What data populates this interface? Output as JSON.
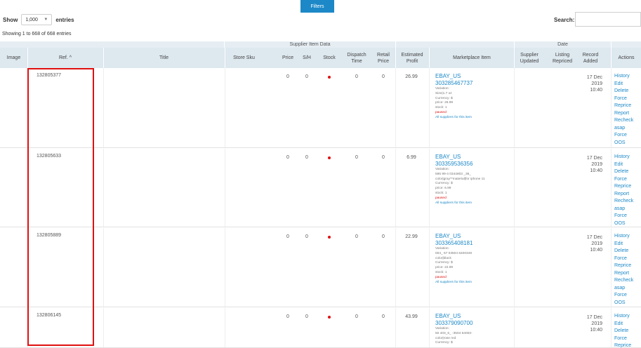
{
  "toolbar": {
    "filters_label": "Filters"
  },
  "length": {
    "show_label": "Show",
    "value": "1,000",
    "entries_label": "entries"
  },
  "search": {
    "label": "Search:",
    "value": ""
  },
  "info": "Showing 1 to 668 of 668 entries",
  "groups": {
    "supplier": "Supplier Item Data",
    "date": "Date"
  },
  "headers": {
    "image": "Image",
    "ref": "Ref. ^",
    "title": "Title",
    "store_sku": "Store Sku",
    "price": "Price",
    "sh": "S/H",
    "stock": "Stock",
    "dispatch": "Dispatch Time",
    "retail": "Retail Price",
    "profit": "Estimated Profit",
    "market": "Marketplace Item",
    "supplier_updated": "Supplier Updated",
    "listing_repriced": "Listing Repriced",
    "record_added": "Record Added",
    "actions": "Actions"
  },
  "colors": {
    "accent": "#1c88c7",
    "stock_dot": "#e01010",
    "highlight": "#e01010"
  },
  "rows": [
    {
      "ref": "132805377",
      "price": "0",
      "sh": "0",
      "dispatch": "0",
      "retail": "0",
      "profit": "26.99",
      "market": "EBAY_US",
      "item_id": "303285467737",
      "details": [
        "Variation:",
        "Size|1.7 oz",
        "Currency: $",
        "price: 26.99",
        "stock: 1"
      ],
      "status": "paused",
      "suppliers_link": "All suppliers for this item",
      "date": [
        "17 Dec",
        "2019",
        "10:40"
      ],
      "actions": [
        "History",
        "Edit",
        "Delete",
        "Force",
        "Reprice",
        "Report",
        "Recheck",
        "asap",
        "Force",
        "OOS"
      ]
    },
    {
      "ref": "132805633",
      "price": "0",
      "sh": "0",
      "dispatch": "0",
      "retail": "0",
      "profit": "6.99",
      "market": "EBAY_US",
      "item_id": "303359536356",
      "details": [
        "Variation:",
        "595 99-4 0344803 _36_",
        "color|gray**material|for iphone 11",
        "Currency: $",
        "price: 6.99",
        "stock: 1"
      ],
      "status": "paused",
      "suppliers_link": "All suppliers for this item",
      "date": [
        "17 Dec",
        "2019",
        "10:40"
      ],
      "actions": [
        "History",
        "Edit",
        "Delete",
        "Force",
        "Reprice",
        "Report",
        "Recheck",
        "asap",
        "Force",
        "OOS"
      ]
    },
    {
      "ref": "132805889",
      "price": "0",
      "sh": "0",
      "dispatch": "0",
      "retail": "0",
      "profit": "22.99",
      "market": "EBAY_US",
      "item_id": "303365408181",
      "details": [
        "Variation:",
        "004_ 57 03504 6400349",
        "color|black",
        "Currency: $",
        "price: 22.99",
        "stock: 1"
      ],
      "status": "paused",
      "suppliers_link": "All suppliers for this item",
      "date": [
        "17 Dec",
        "2019",
        "10:40"
      ],
      "actions": [
        "History",
        "Edit",
        "Delete",
        "Force",
        "Reprice",
        "Report",
        "Recheck",
        "asap",
        "Force",
        "OOS"
      ]
    },
    {
      "ref": "132806145",
      "price": "0",
      "sh": "0",
      "dispatch": "0",
      "retail": "0",
      "profit": "43.99",
      "market": "EBAY_US",
      "item_id": "303379090700",
      "details": [
        "Variation:",
        "50 403_6_ -3504 64003-",
        "color|rose red",
        "Currency: $"
      ],
      "status": "",
      "suppliers_link": "",
      "date": [
        "17 Dec",
        "2019",
        "10:40"
      ],
      "actions": [
        "History",
        "Edit",
        "Delete",
        "Force",
        "Reprice"
      ]
    }
  ]
}
